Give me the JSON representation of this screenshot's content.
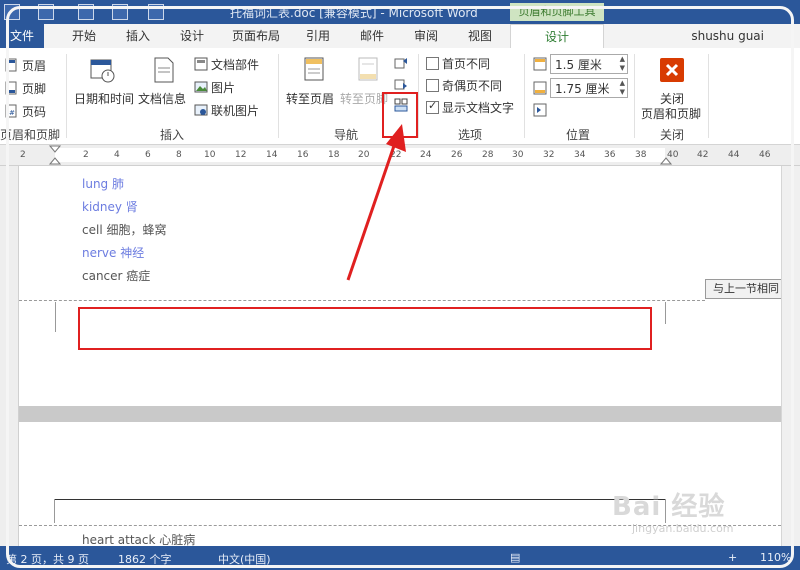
{
  "window": {
    "title": "托福词汇表.doc [兼容模式] - Microsoft Word",
    "context_tab_title": "页眉和页脚工具",
    "user": "shushu guai"
  },
  "tabs": [
    {
      "label": "文件"
    },
    {
      "label": "开始"
    },
    {
      "label": "插入"
    },
    {
      "label": "设计"
    },
    {
      "label": "页面布局"
    },
    {
      "label": "引用"
    },
    {
      "label": "邮件"
    },
    {
      "label": "审阅"
    },
    {
      "label": "视图"
    },
    {
      "label": "设计"
    }
  ],
  "ribbon": {
    "header_footer_group": {
      "items": [
        "页眉",
        "页脚",
        "页码"
      ],
      "label": "页眉和页脚"
    },
    "insert_group": {
      "datetime": "日期和时间",
      "docinfo": "文档信息",
      "docparts": "文档部件",
      "picture": "图片",
      "online_picture": "联机图片",
      "label": "插入"
    },
    "nav_group": {
      "goto_header": "转至页眉",
      "goto_footer": "转至页脚",
      "label": "导航"
    },
    "options_group": {
      "first_page_diff": "首页不同",
      "odd_even_diff": "奇偶页不同",
      "show_doc_text": "显示文档文字",
      "label": "选项"
    },
    "position_group": {
      "header_pos": "1.5 厘米",
      "footer_pos": "1.75 厘米",
      "label": "位置"
    },
    "close_group": {
      "close_line1": "关闭",
      "close_line2": "页眉和页脚",
      "label": "关闭"
    }
  },
  "ruler_ticks": [
    "2",
    "2",
    "4",
    "6",
    "8",
    "10",
    "12",
    "14",
    "16",
    "18",
    "20",
    "22",
    "24",
    "26",
    "28",
    "30",
    "32",
    "34",
    "36",
    "38",
    "40",
    "42",
    "44",
    "46"
  ],
  "document": {
    "words": [
      {
        "text": "lung  肺",
        "style": "blue"
      },
      {
        "text": "kidney  肾",
        "style": "blue"
      },
      {
        "text": "cell  细胞，蜂窝",
        "style": "gray"
      },
      {
        "text": "nerve  神经",
        "style": "blue"
      },
      {
        "text": "cancer  癌症",
        "style": "gray"
      }
    ],
    "same_as_previous": "与上一节相同",
    "next_page_word": "heart attack  心脏病"
  },
  "status": {
    "page": "第 2 页，共 9 页",
    "words": "1862 个字",
    "language": "中文(中国)",
    "zoom": "110%"
  },
  "watermark": {
    "text": "Bai 经验",
    "sub": "jingyan.baidu.com"
  },
  "colors": {
    "accent": "#2b579a",
    "context_green": "#2e7d32",
    "annotation_red": "#e02020"
  }
}
